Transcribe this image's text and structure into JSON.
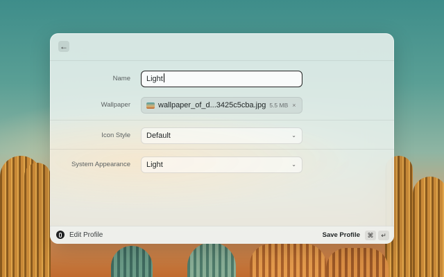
{
  "form": {
    "name": {
      "label": "Name",
      "value": "Light"
    },
    "wallpaper": {
      "label": "Wallpaper",
      "file_name": "wallpaper_of_d...3425c5cba.jpg",
      "file_size": "5.5 MB",
      "remove_glyph": "×"
    },
    "icon_style": {
      "label": "Icon Style",
      "value": "Default"
    },
    "system_appearance": {
      "label": "System Appearance",
      "value": "Light"
    }
  },
  "footer": {
    "title": "Edit Profile",
    "save_label": "Save Profile",
    "shortcut_cmd": "⌘",
    "shortcut_return": "↵"
  },
  "icons": {
    "back": "←",
    "chevron": "⌄"
  }
}
